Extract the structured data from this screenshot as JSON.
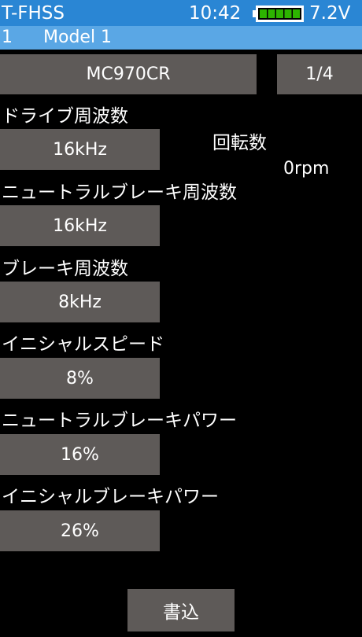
{
  "status_bar": {
    "protocol": "T-FHSS",
    "time": "10:42",
    "battery_icon": "battery-full-icon",
    "battery_color": "#2DB400",
    "voltage": "7.2V"
  },
  "model_bar": {
    "number": "1",
    "name": "Model 1"
  },
  "header": {
    "esc_model": "MC970CR",
    "page": "1/4"
  },
  "rpm": {
    "label": "回転数",
    "value": "0rpm"
  },
  "params": [
    {
      "label": "ドライブ周波数",
      "value": "16kHz"
    },
    {
      "label": "ニュートラルブレーキ周波数",
      "value": "16kHz"
    },
    {
      "label": "ブレーキ周波数",
      "value": "8kHz"
    },
    {
      "label": "イニシャルスピード",
      "value": "8%"
    },
    {
      "label": "ニュートラルブレーキパワー",
      "value": "16%"
    },
    {
      "label": "イニシャルブレーキパワー",
      "value": "26%"
    }
  ],
  "write_button": "書込",
  "colors": {
    "status_bar": "#2A86D4",
    "model_bar": "#5AA7E5",
    "button_gray": "#5E5A58",
    "background": "#000000"
  }
}
